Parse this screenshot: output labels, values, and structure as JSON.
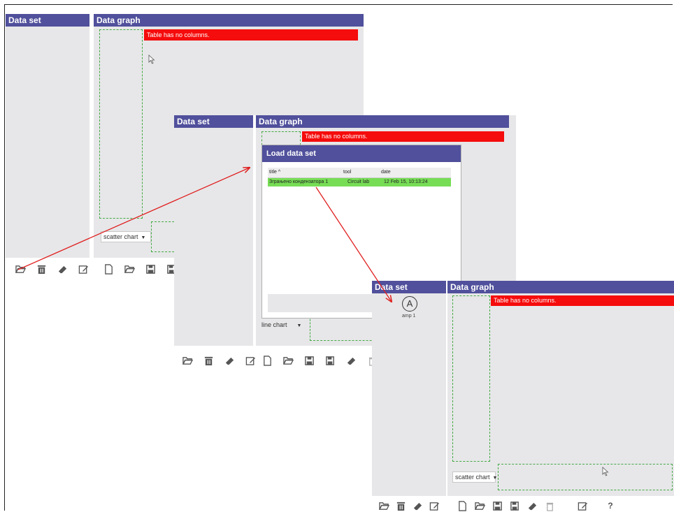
{
  "screenshot1": {
    "data_set_header": "Data set",
    "data_graph_header": "Data graph",
    "error_message": "Table has no columns.",
    "chart_type_select": "scatter chart",
    "dataset_toolbar": [
      "open-icon",
      "delete-icon",
      "eraser-icon",
      "edit-icon"
    ],
    "graph_toolbar": [
      "new-file-icon",
      "open-icon",
      "save-icon",
      "save-as-icon"
    ]
  },
  "screenshot2": {
    "data_set_header": "Data set",
    "data_graph_header": "Data graph",
    "error_message": "Table has no columns.",
    "chart_type_select": "line chart",
    "dataset_toolbar": [
      "open-icon",
      "delete-icon",
      "eraser-icon",
      "edit-icon"
    ],
    "graph_toolbar": [
      "new-file-icon",
      "open-icon",
      "save-icon",
      "save-as-icon",
      "eraser-icon",
      "trash-icon"
    ],
    "dialog": {
      "title": "Load data set",
      "columns": [
        "title ^",
        "tool",
        "date"
      ],
      "rows": [
        {
          "title": "Зграњено кондензатора 1",
          "tool": "Circuit lab",
          "date": "12 Feb 15, 10:13:24"
        }
      ]
    }
  },
  "screenshot3": {
    "data_set_header": "Data set",
    "data_graph_header": "Data graph",
    "error_message": "Table has no columns.",
    "chart_type_select": "scatter chart",
    "dataset_item": {
      "icon_letter": "A",
      "label": "amp 1"
    },
    "dataset_toolbar": [
      "open-icon",
      "delete-icon",
      "eraser-icon",
      "edit-icon"
    ],
    "graph_toolbar": [
      "new-file-icon",
      "open-icon",
      "save-icon",
      "save-as-icon",
      "eraser-icon",
      "trash-icon"
    ],
    "extra_toolbar": [
      "edit-icon",
      "help-icon"
    ],
    "help_label": "?"
  },
  "colors": {
    "header": "#50509c",
    "error": "#f50c0c",
    "selected_row": "#77dd55",
    "panel": "#e7e7e9",
    "annotation_arrow": "#e02020"
  }
}
